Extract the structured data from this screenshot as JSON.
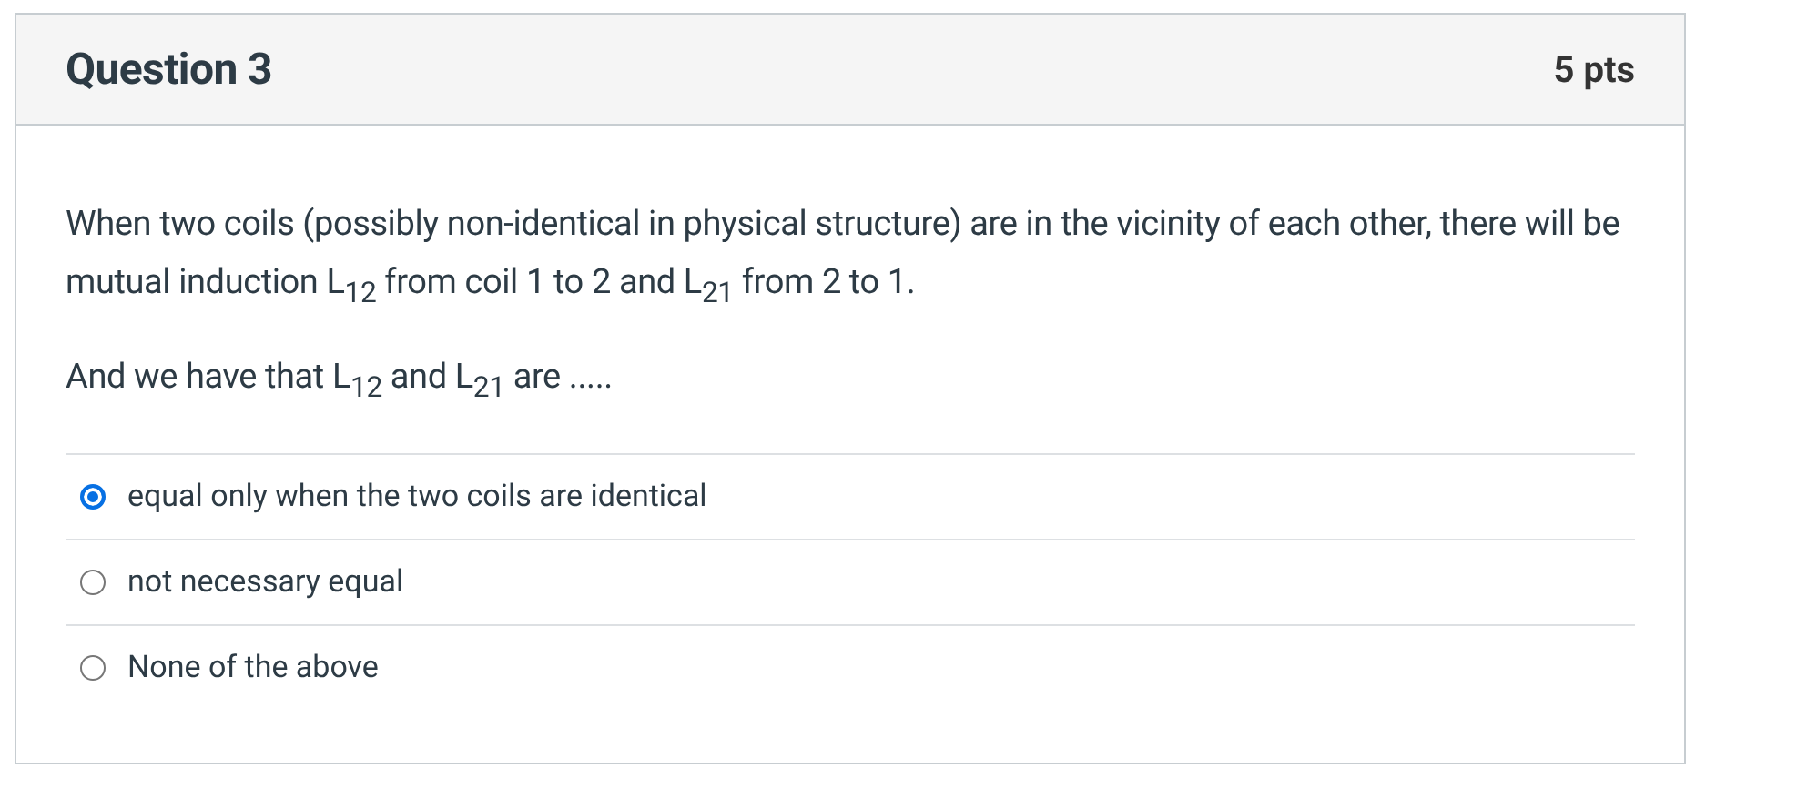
{
  "question": {
    "title": "Question 3",
    "points": "5 pts"
  },
  "paragraphs": [
    "When two coils (possibly non-identical in physical structure) are in the vicinity of each other, there will be mutual induction L$_{12}$ from coil 1 to 2 and L$_{21}$ from 2 to 1.",
    "And we have that L$_{12}$ and L$_{21}$ are ....."
  ],
  "options": [
    {
      "label": "equal only when the two coils are identical",
      "selected": true
    },
    {
      "label": "not necessary equal",
      "selected": false
    },
    {
      "label": "None of the above",
      "selected": false
    }
  ]
}
